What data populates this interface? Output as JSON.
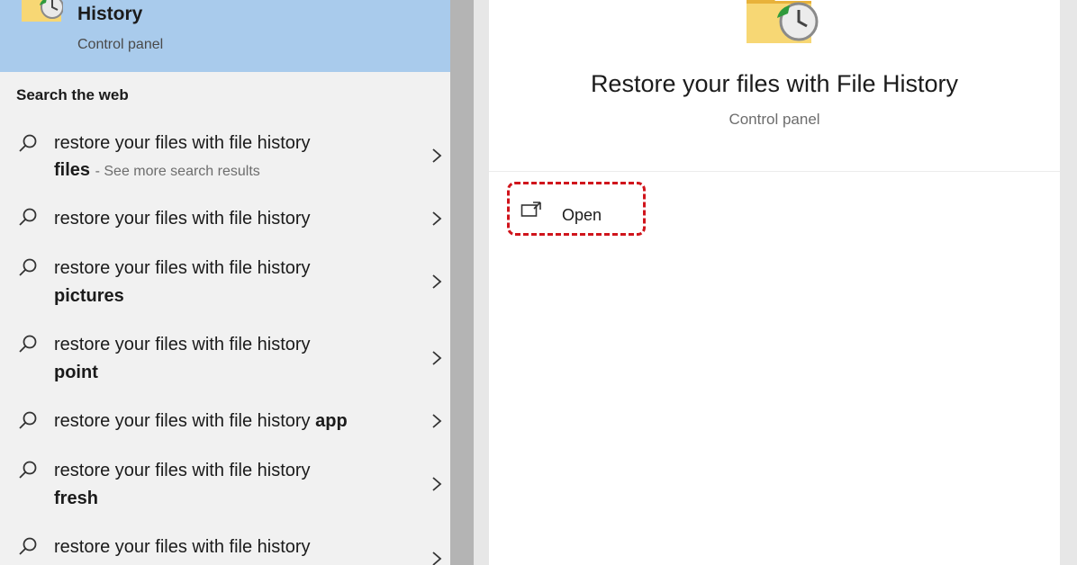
{
  "best_match": {
    "title": "History",
    "subtitle": "Control panel",
    "icon": "file-history-icon"
  },
  "web_section": {
    "label": "Search the web",
    "results": [
      {
        "text": "restore your files with file history",
        "bold": "files",
        "extra": "- See more search results"
      },
      {
        "text": "restore your files with file history",
        "bold": "",
        "extra": ""
      },
      {
        "text": "restore your files with file history",
        "bold": "pictures",
        "extra": ""
      },
      {
        "text": "restore your files with file history",
        "bold": "point",
        "extra": ""
      },
      {
        "text": "restore your files with file history",
        "bold": "app",
        "extra": ""
      },
      {
        "text": "restore your files with file history",
        "bold": "fresh",
        "extra": ""
      },
      {
        "text": "restore your files with file history",
        "bold": "",
        "extra": ""
      }
    ]
  },
  "preview": {
    "title": "Restore your files with File History",
    "subtitle": "Control panel",
    "icon": "file-history-icon",
    "actions": [
      {
        "label": "Open",
        "icon": "open-window-icon"
      }
    ]
  },
  "colors": {
    "selected_bg": "#a9cbec",
    "left_bg": "#f1f1f1",
    "highlight_border": "#d0141c"
  }
}
